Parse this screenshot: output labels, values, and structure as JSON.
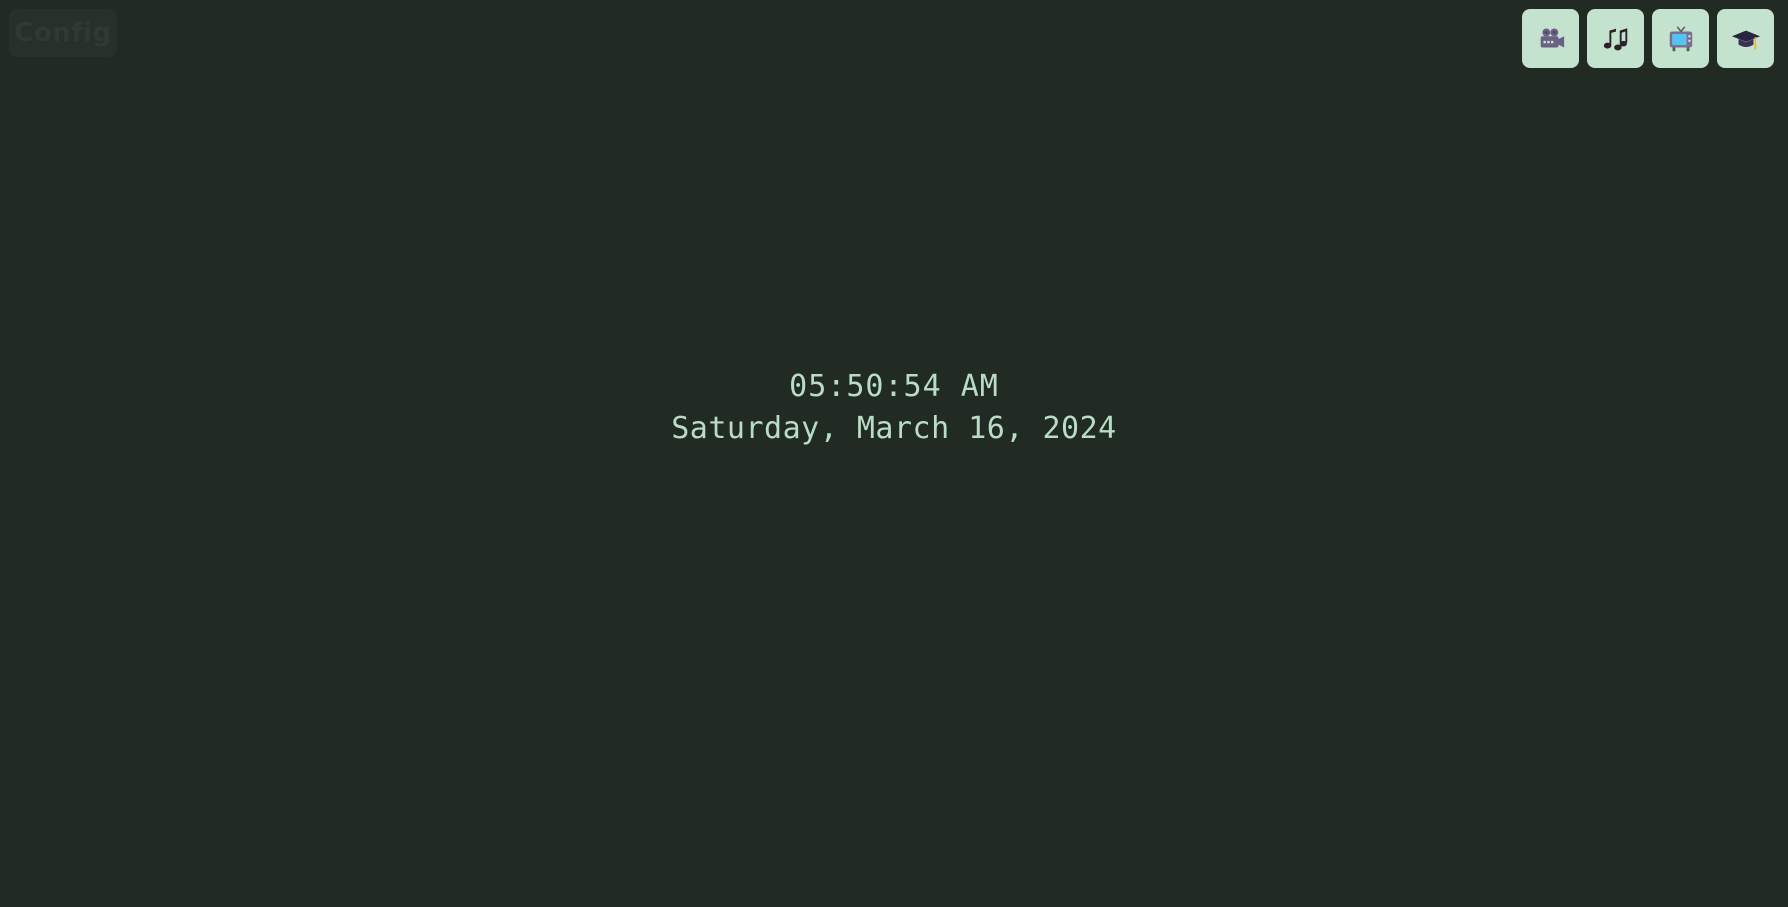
{
  "config": {
    "label": "Config"
  },
  "launcher": {
    "items": [
      {
        "name": "movie-camera",
        "icon": "movie-camera-icon"
      },
      {
        "name": "music",
        "icon": "music-notes-icon"
      },
      {
        "name": "television",
        "icon": "television-icon"
      },
      {
        "name": "education",
        "icon": "graduation-cap-icon"
      }
    ]
  },
  "clock": {
    "time": "05:50:54 AM",
    "date": "Saturday, March 16, 2024"
  },
  "colors": {
    "background": "#222a24",
    "accent": "#c3e3cf",
    "text": "#b9dcc5"
  }
}
